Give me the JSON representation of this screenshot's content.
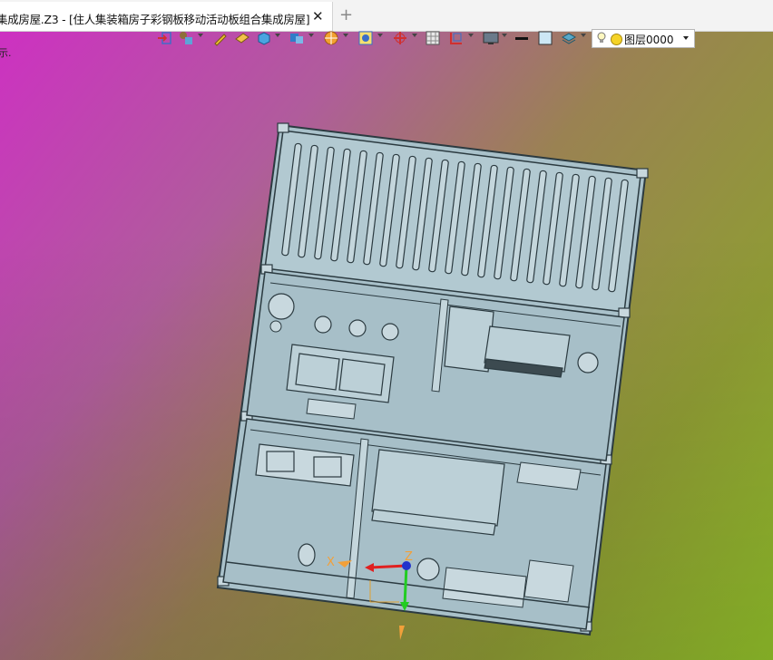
{
  "tab": {
    "title": "集成房屋.Z3 - [住人集装箱房子彩钢板移动活动板组合集成房屋]",
    "close_glyph": "✕",
    "add_glyph": "+"
  },
  "toolbar": {
    "items": [
      "exit-icon",
      "pick-filter-icon",
      "pen-icon",
      "eraser-icon",
      "solid-box-icon",
      "render-mode-icon",
      "section-icon",
      "view-icon",
      "rotate-icon",
      "grid-icon",
      "orient-icon",
      "display-icon",
      "line-weight-icon",
      "color-swatch-icon",
      "layer-stack-icon"
    ],
    "layer": {
      "value": "图层0000",
      "color": "#f5d327"
    }
  },
  "status_fragment": "示.",
  "viewport": {
    "background_colors": [
      "#cf2ec4",
      "#9a8252",
      "#93c32a"
    ],
    "model_color": "#a8c0c8",
    "axes": {
      "x_label": "X",
      "z_label": "Z"
    }
  }
}
